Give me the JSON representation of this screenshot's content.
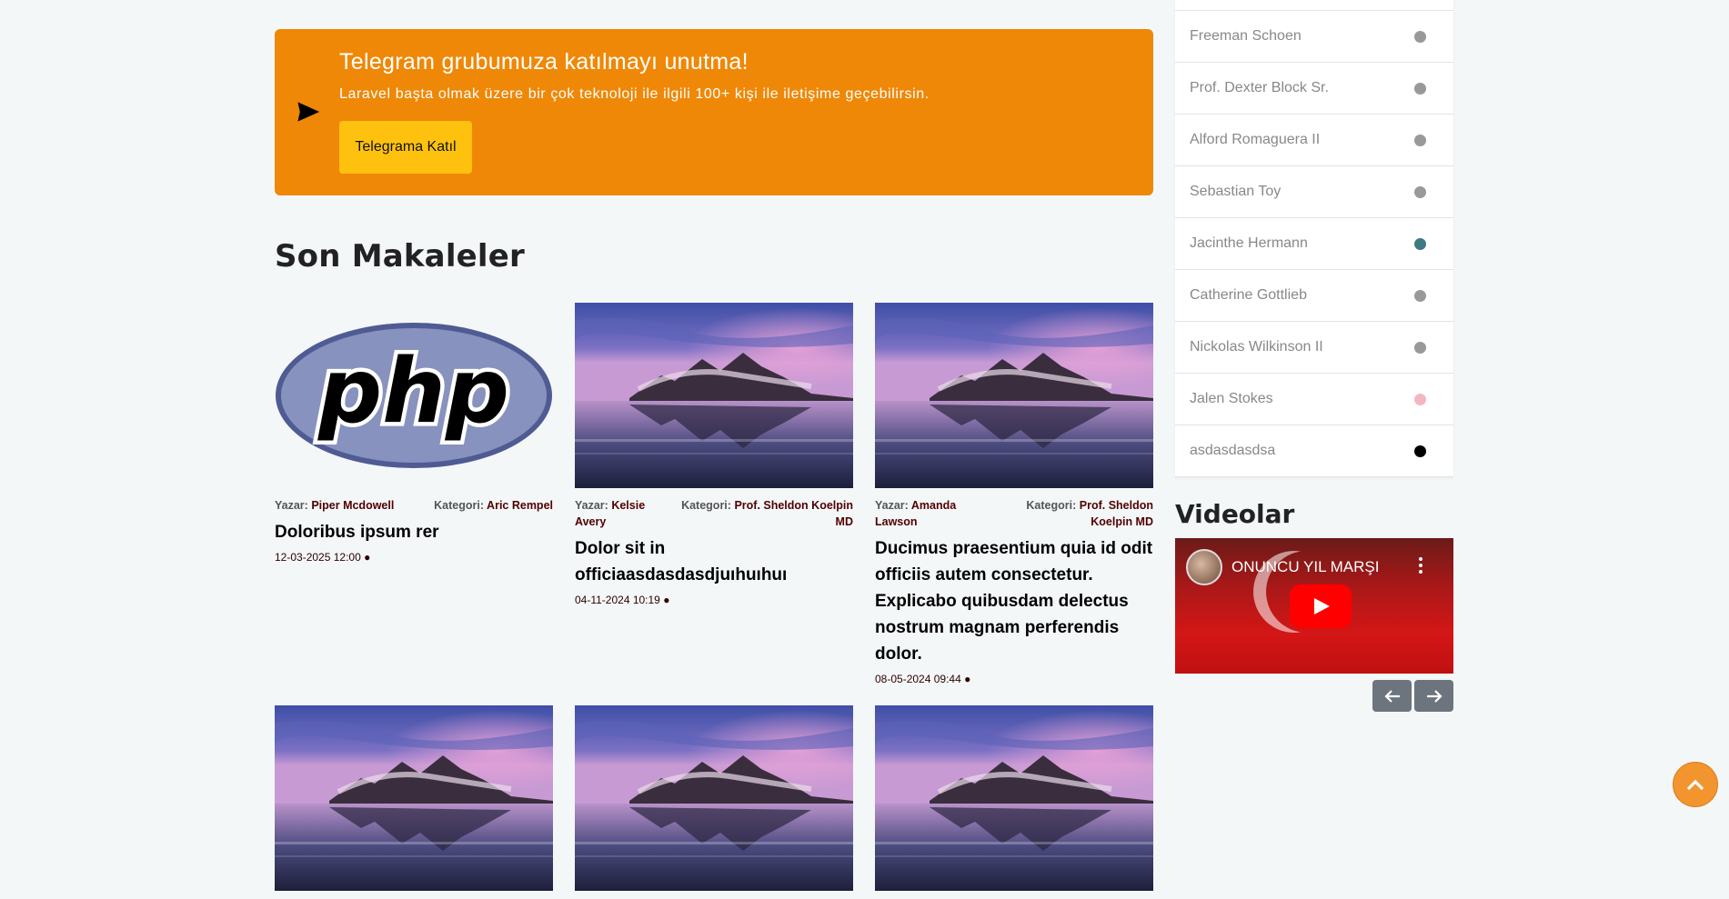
{
  "telegram": {
    "title": "Telegram grubumuza katılmayı unutma!",
    "subtitle": "Laravel başta olmak üzere bir çok teknoloji ile ilgili 100+ kişi ile iletişime geçebilirsin.",
    "button_label": "Telegrama Katıl"
  },
  "section_title": "Son Makaleler",
  "labels": {
    "author": "Yazar:",
    "category": "Kategori:"
  },
  "articles": [
    {
      "author": "Piper Mcdowell",
      "category": "Aric Rempel",
      "title": "Doloribus ipsum rer",
      "date": "12-03-2025 12:00 ●",
      "image": "php-logo"
    },
    {
      "author": "Kelsie Avery",
      "category": "Prof. Sheldon Koelpin MD",
      "title": "Dolor sit in officiaasdasdasdjuıhuıhuı",
      "date": "04-11-2024 10:19 ●",
      "image": "landscape"
    },
    {
      "author": "Amanda Lawson",
      "category": "Prof. Sheldon Koelpin MD",
      "title": "Ducimus praesentium quia id odit officiis autem consectetur. Explicabo quibusdam delectus nostrum magnam perferendis dolor.",
      "date": "08-05-2024 09:44 ●",
      "image": "landscape"
    }
  ],
  "users": [
    {
      "name": "Freeman Schoen",
      "color": "#999999"
    },
    {
      "name": "Prof. Dexter Block Sr.",
      "color": "#999999"
    },
    {
      "name": "Alford Romaguera II",
      "color": "#999999"
    },
    {
      "name": "Sebastian Toy",
      "color": "#999999"
    },
    {
      "name": "Jacinthe Hermann",
      "color": "#3d7a84"
    },
    {
      "name": "Catherine Gottlieb",
      "color": "#999999"
    },
    {
      "name": "Nickolas Wilkinson II",
      "color": "#999999"
    },
    {
      "name": "Jalen Stokes",
      "color": "#f5b6c4"
    },
    {
      "name": "asdasdasdsa",
      "color": "#000000"
    }
  ],
  "videos": {
    "title": "Videolar",
    "video_title": "ONUNCU YIL MARŞI"
  },
  "colors": {
    "banner": "#ef8807",
    "button": "#fec20e",
    "scroll_top": "#f2952e",
    "nav": "#6c757d"
  }
}
